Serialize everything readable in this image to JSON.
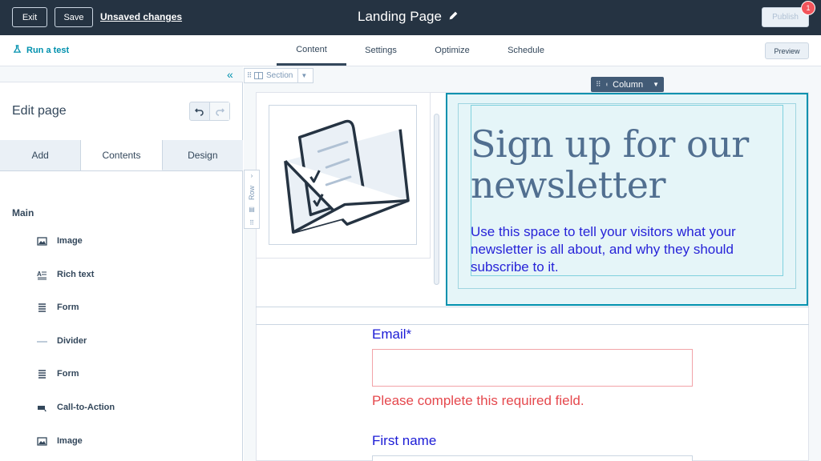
{
  "topbar": {
    "exit_label": "Exit",
    "save_label": "Save",
    "unsaved_label": "Unsaved changes",
    "page_title": "Landing Page",
    "publish_label": "Publish",
    "notification_count": "1"
  },
  "tabbar": {
    "run_test_label": "Run a test",
    "tabs": [
      "Content",
      "Settings",
      "Optimize",
      "Schedule"
    ],
    "active_tab": "Content",
    "preview_label": "Preview"
  },
  "sidebar": {
    "title": "Edit page",
    "tabs": [
      "Add",
      "Contents",
      "Design"
    ],
    "active_tab": "Contents",
    "group_label": "Main",
    "items": [
      {
        "label": "Image",
        "icon": "image-icon"
      },
      {
        "label": "Rich text",
        "icon": "rich-text-icon"
      },
      {
        "label": "Form",
        "icon": "form-icon"
      },
      {
        "label": "Divider",
        "icon": "divider-icon"
      },
      {
        "label": "Form",
        "icon": "form-icon"
      },
      {
        "label": "Call-to-Action",
        "icon": "cta-icon"
      },
      {
        "label": "Image",
        "icon": "image-icon"
      }
    ]
  },
  "canvas": {
    "section_label": "Section",
    "row_label": "Row",
    "column_label": "Column",
    "headline": "Sign up for our newsletter",
    "subtext": "Use this space to tell your visitors what your newsletter is all about, and why they should subscribe to it.",
    "form": {
      "email_label": "Email*",
      "email_error": "Please complete this required field.",
      "first_name_label": "First name"
    }
  },
  "colors": {
    "topbar_bg": "#253342",
    "accent": "#0091ae",
    "selection_fill": "#e5f5f8",
    "error": "#e5484d",
    "form_label": "#1b1bd6",
    "headline": "#516f90"
  }
}
